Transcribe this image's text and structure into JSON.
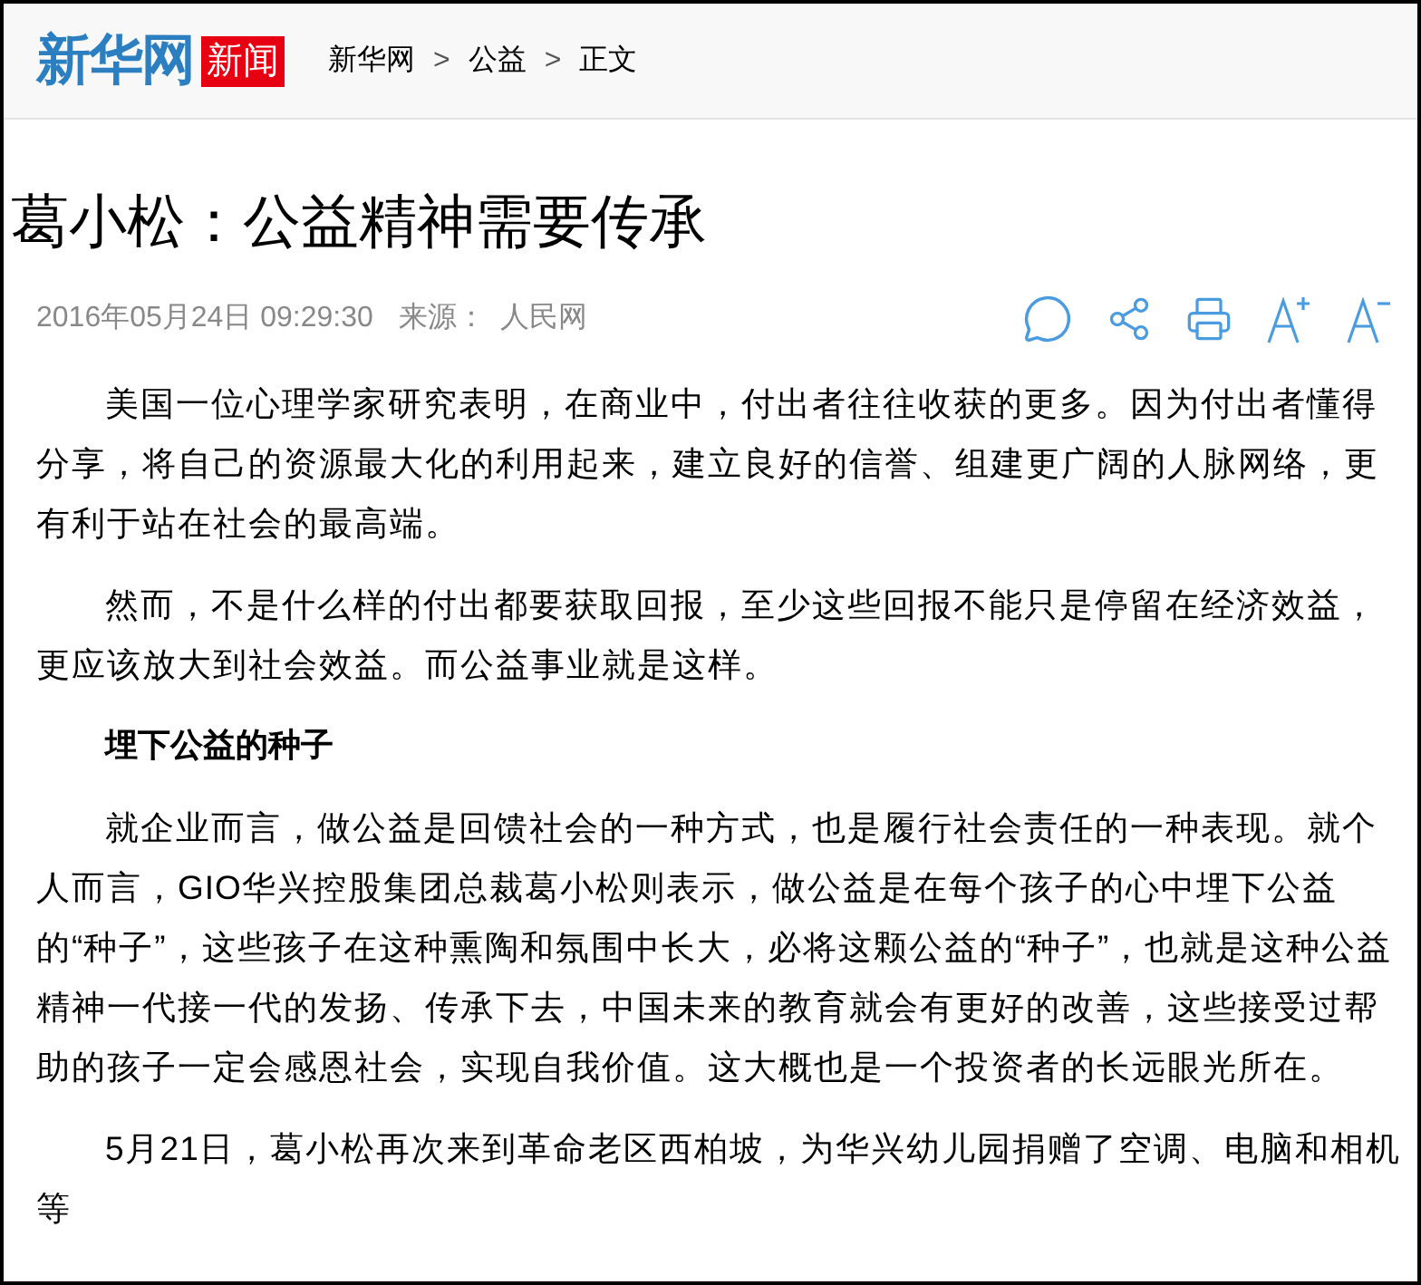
{
  "header": {
    "logo_text": "新华网",
    "logo_badge": "新闻",
    "breadcrumb": [
      {
        "label": "新华网"
      },
      {
        "label": "公益"
      },
      {
        "label": "正文"
      }
    ],
    "separator": ">"
  },
  "article": {
    "title": "葛小松：公益精神需要传承",
    "date": "2016年05月24日 09:29:30",
    "source_label": "来源：",
    "source": "人民网",
    "toolbar": [
      {
        "kind": "comment"
      },
      {
        "kind": "share"
      },
      {
        "kind": "print"
      },
      {
        "kind": "font-up"
      },
      {
        "kind": "font-down"
      }
    ],
    "paragraphs": [
      {
        "kind": "text",
        "text": "美国一位心理学家研究表明，在商业中，付出者往往收获的更多。因为付出者懂得分享，将自己的资源最大化的利用起来，建立良好的信誉、组建更广阔的人脉网络，更有利于站在社会的最高端。"
      },
      {
        "kind": "text",
        "text": "然而，不是什么样的付出都要获取回报，至少这些回报不能只是停留在经济效益，更应该放大到社会效益。而公益事业就是这样。"
      },
      {
        "kind": "heading",
        "text": "埋下公益的种子"
      },
      {
        "kind": "text",
        "text": "就企业而言，做公益是回馈社会的一种方式，也是履行社会责任的一种表现。就个人而言，GIO华兴控股集团总裁葛小松则表示，做公益是在每个孩子的心中埋下公益的“种子”，这些孩子在这种熏陶和氛围中长大，必将这颗公益的“种子”，也就是这种公益精神一代接一代的发扬、传承下去，中国未来的教育就会有更好的改善，这些接受过帮助的孩子一定会感恩社会，实现自我价值。这大概也是一个投资者的长远眼光所在。"
      },
      {
        "kind": "text",
        "text": "5月21日，葛小松再次来到革命老区西柏坡，为华兴幼儿园捐赠了空调、电脑和相机等"
      }
    ]
  }
}
